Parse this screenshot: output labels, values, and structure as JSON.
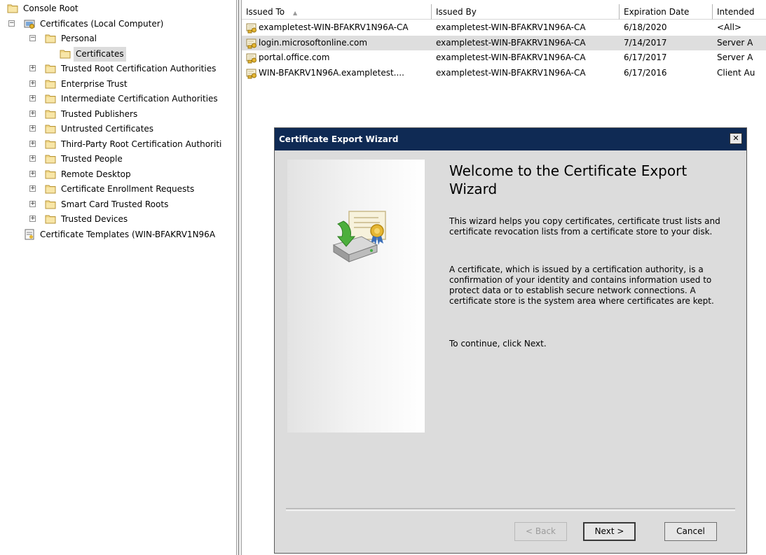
{
  "tree": {
    "items": [
      {
        "label": "Console Root"
      },
      {
        "label": "Certificates (Local Computer)",
        "expander": "−"
      },
      {
        "label": "Personal",
        "expander": "−"
      },
      {
        "label": "Certificates"
      },
      {
        "label": "Trusted Root Certification Authorities",
        "expander": "+"
      },
      {
        "label": "Enterprise Trust",
        "expander": "+"
      },
      {
        "label": "Intermediate Certification Authorities",
        "expander": "+"
      },
      {
        "label": "Trusted Publishers",
        "expander": "+"
      },
      {
        "label": "Untrusted Certificates",
        "expander": "+"
      },
      {
        "label": "Third-Party Root Certification Authoriti",
        "expander": "+"
      },
      {
        "label": "Trusted People",
        "expander": "+"
      },
      {
        "label": "Remote Desktop",
        "expander": "+"
      },
      {
        "label": "Certificate Enrollment Requests",
        "expander": "+"
      },
      {
        "label": "Smart Card Trusted Roots",
        "expander": "+"
      },
      {
        "label": "Trusted Devices",
        "expander": "+"
      },
      {
        "label": "Certificate Templates (WIN-BFAKRV1N96A"
      }
    ]
  },
  "list": {
    "columns": {
      "issued_to": "Issued To",
      "sort_indicator": "▲",
      "issued_by": "Issued By",
      "expiration": "Expiration Date",
      "intended": "Intended"
    },
    "rows": [
      {
        "issued_to": "exampletest-WIN-BFAKRV1N96A-CA",
        "issued_by": "exampletest-WIN-BFAKRV1N96A-CA",
        "expiration": "6/18/2020",
        "intended": "<All>"
      },
      {
        "issued_to": "login.microsoftonline.com",
        "issued_by": "exampletest-WIN-BFAKRV1N96A-CA",
        "expiration": "7/14/2017",
        "intended": "Server A"
      },
      {
        "issued_to": "portal.office.com",
        "issued_by": "exampletest-WIN-BFAKRV1N96A-CA",
        "expiration": "6/17/2017",
        "intended": "Server A"
      },
      {
        "issued_to": "WIN-BFAKRV1N96A.exampletest....",
        "issued_by": "exampletest-WIN-BFAKRV1N96A-CA",
        "expiration": "6/17/2016",
        "intended": "Client Au"
      }
    ]
  },
  "wizard": {
    "title": "Certificate Export Wizard",
    "close_glyph": "✕",
    "heading": "Welcome to the Certificate Export Wizard",
    "para1": "This wizard helps you copy certificates, certificate trust lists and certificate revocation lists from a certificate store to your disk.",
    "para2": "A certificate, which is issued by a certification authority, is a confirmation of your identity and contains information used to protect data or to establish secure network connections. A certificate store is the system area where certificates are kept.",
    "para3": "To continue, click Next.",
    "back_label": "< Back",
    "next_label": "Next >",
    "cancel_label": "Cancel"
  },
  "colors": {
    "titlebar": "#0f2a54",
    "dialog_bg": "#dcdcdc",
    "folder": "#f2d98a"
  }
}
